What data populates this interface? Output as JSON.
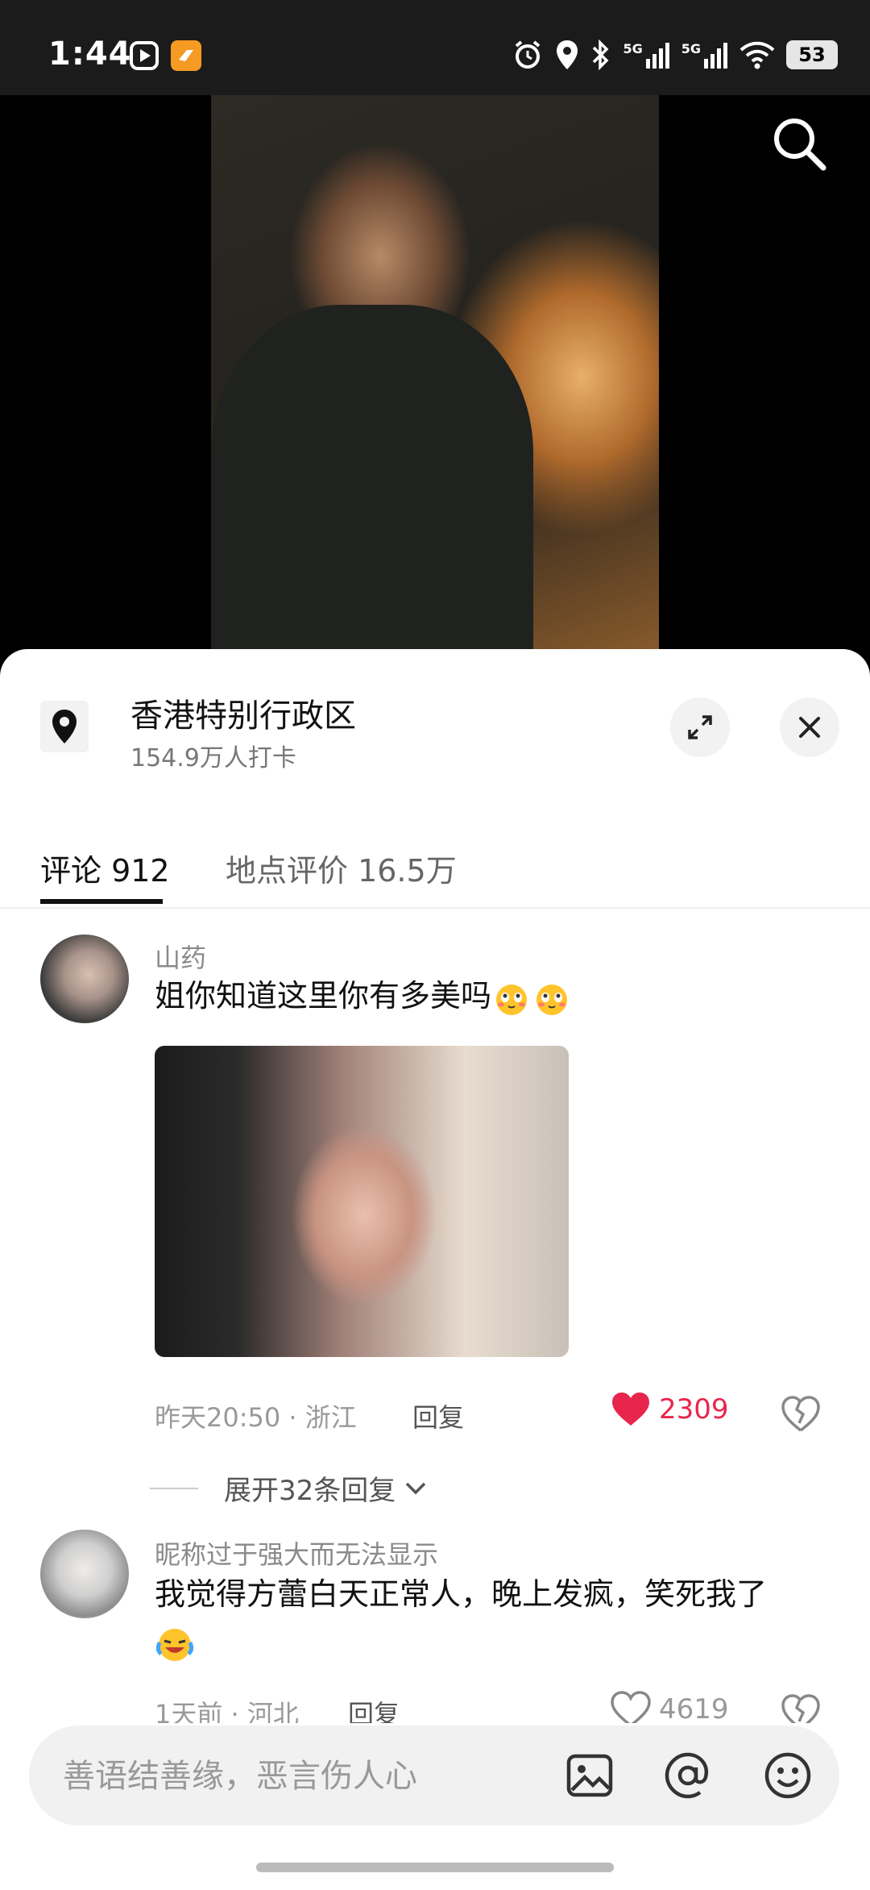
{
  "status_bar": {
    "time": "1:44",
    "battery": "53",
    "network_1": "5G",
    "network_2": "5G"
  },
  "location": {
    "title": "香港特别行政区",
    "subtitle": "154.9万人打卡"
  },
  "tabs": [
    {
      "label": "评论 912",
      "active": true
    },
    {
      "label": "地点评价 16.5万",
      "active": false
    }
  ],
  "comments": [
    {
      "username": "山药",
      "text": "姐你知道这里你有多美吗",
      "time_location": "昨天20:50 · 浙江",
      "reply_label": "回复",
      "likes": "2309",
      "liked": true,
      "expand_label": "展开32条回复"
    },
    {
      "username": "昵称过于强大而无法显示",
      "text": "我觉得方蕾白天正常人，晚上发疯，笑死我了",
      "time_location": "1天前 · 河北",
      "reply_label": "回复",
      "likes": "4619"
    }
  ],
  "input": {
    "placeholder": "善语结善缘，恶言伤人心"
  },
  "colors": {
    "like_red": "#e8264d",
    "sheet_bg": "#ffffff",
    "status_bg": "#1b1b1b"
  }
}
